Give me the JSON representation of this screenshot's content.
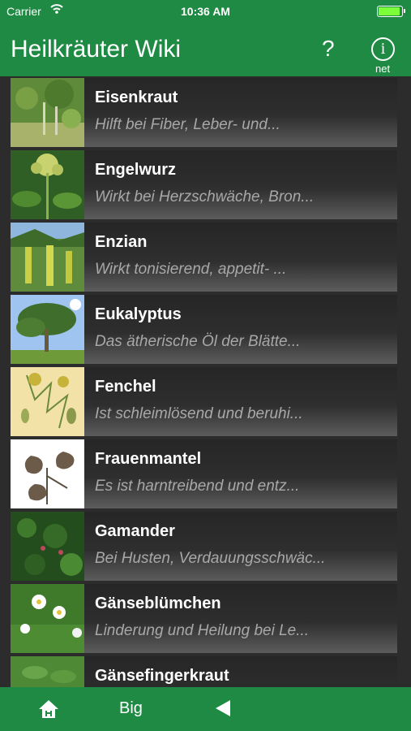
{
  "status": {
    "carrier": "Carrier",
    "time": "10:36 AM"
  },
  "nav": {
    "title": "Heilkräuter Wiki",
    "help_label": "?",
    "info_label": "i",
    "info_sub": "net"
  },
  "items": [
    {
      "name": "Eisenkraut",
      "desc": "Hilft bei Fiber, Leber- und..."
    },
    {
      "name": "Engelwurz",
      "desc": "Wirkt bei Herzschwäche, Bron..."
    },
    {
      "name": "Enzian",
      "desc": "Wirkt tonisierend, appetit- ..."
    },
    {
      "name": "Eukalyptus",
      "desc": "Das ätherische Öl der Blätte..."
    },
    {
      "name": "Fenchel",
      "desc": "Ist schleimlösend und beruhi..."
    },
    {
      "name": "Frauenmantel",
      "desc": "Es ist harntreibend und entz..."
    },
    {
      "name": "Gamander",
      "desc": "Bei Husten, Verdauungsschwäc..."
    },
    {
      "name": "Gänseblümchen",
      "desc": "Linderung und Heilung bei Le..."
    },
    {
      "name": "Gänsefingerkraut",
      "desc": ""
    }
  ],
  "tabbar": {
    "big_label": "Big"
  },
  "colors": {
    "accent": "#1f8a43",
    "background": "#2b2b2b",
    "text": "#ffffff",
    "subtext": "#a8a8a8"
  }
}
